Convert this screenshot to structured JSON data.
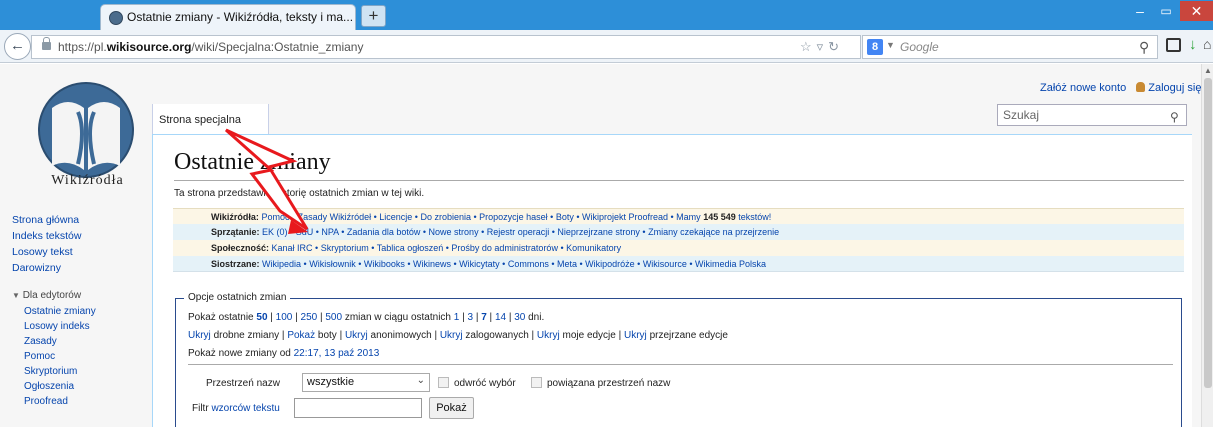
{
  "browser": {
    "tab_title": "Ostatnie zmiany - Wikiźródła, teksty i ma...",
    "new_tab_label": "+",
    "url_prefix": "https://pl.",
    "url_domain": "wikisource.org",
    "url_path": "/wiki/Specjalna:Ostatnie_zmiany",
    "search_placeholder": "Google",
    "google_letter": "8",
    "window_min": "–",
    "window_max": "▭",
    "window_close": "✕"
  },
  "wiki": {
    "logo_text": "Wikiźródła",
    "create_account": "Załóż nowe konto",
    "login": "Zaloguj się",
    "special_tab": "Strona specjalna",
    "search_placeholder": "Szukaj",
    "title": "Ostatnie zmiany",
    "intro": "Ta strona przedstawia historię ostatnich zmian w tej wiki."
  },
  "nav": {
    "r1_label": "Wikiźródła:",
    "r1_links": "Pomoc • Zasady Wikiźródeł • Licencje • Do zrobienia • Propozycje haseł • Boty • Wikiprojekt Proofread • Mamy",
    "r1_count": "145 549",
    "r1_tail": "tekstów!",
    "r2_label": "Sprzątanie:",
    "r2_links": "EK (0) • SdU • NPA • Zadania dla botów • Nowe strony • Rejestr operacji • Nieprzejrzane strony • Zmiany czekające na przejrzenie",
    "r3_label": "Społeczność:",
    "r3_links": "Kanał IRC • Skryptorium • Tablica ogłoszeń • Prośby do administratorów • Komunikatory",
    "r4_label": "Siostrzane:",
    "r4_links": "Wikipedia • Wikisłownik • Wikibooks • Wikinews • Wikicytaty • Commons • Meta • Wikipodróże • Wikisource • Wikimedia Polska"
  },
  "options": {
    "legend": "Opcje ostatnich zmian",
    "show_last": "Pokaż ostatnie",
    "limits": [
      "50",
      "100",
      "250",
      "500"
    ],
    "limits_mid": "zmian w ciągu ostatnich",
    "days": [
      "1",
      "3",
      "7",
      "14",
      "30"
    ],
    "days_suffix": "dni.",
    "hide": "Ukryj",
    "show": "Pokaż",
    "minor": "drobne zmiany",
    "bots": "boty",
    "anons": "anonimowych",
    "loggedin": "zalogowanych",
    "mine": "moje edycje",
    "patrolled": "przejrzane edycje",
    "newfrom_prefix": "Pokaż nowe zmiany od",
    "newfrom_date": "22:17, 13 paź 2013",
    "namespace_label": "Przestrzeń nazw",
    "namespace_value": "wszystkie",
    "invert_label": "odwróć wybór",
    "associated_label": "powiązana przestrzeń nazw",
    "filter_prefix": "Filtr",
    "filter_link": "wzorców tekstu",
    "submit": "Pokaż"
  },
  "sidebar": {
    "main": [
      "Strona główna",
      "Indeks tekstów",
      "Losowy tekst",
      "Darowizny"
    ],
    "group_title": "Dla edytorów",
    "group_items": [
      "Ostatnie zmiany",
      "Losowy indeks",
      "Zasady",
      "Pomoc",
      "Skryptorium",
      "Ogłoszenia",
      "Proofread"
    ]
  },
  "colors": {
    "link": "#0645ad",
    "titlebar": "#2d8fd8",
    "annotation": "#e8191d"
  }
}
